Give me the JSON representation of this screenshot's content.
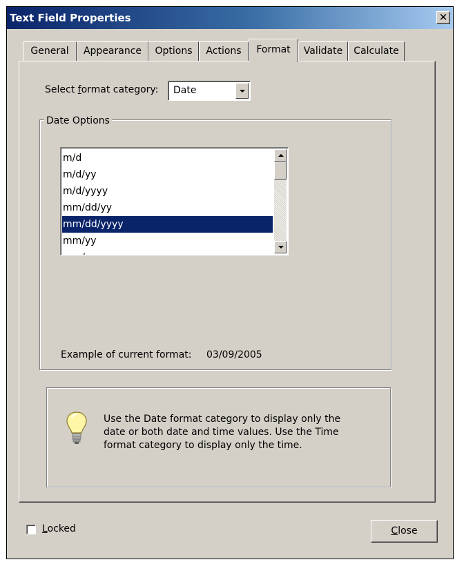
{
  "window": {
    "title": "Text Field Properties",
    "close_glyph": "✕"
  },
  "tabs": [
    {
      "label": "General",
      "active": false
    },
    {
      "label": "Appearance",
      "active": false
    },
    {
      "label": "Options",
      "active": false
    },
    {
      "label": "Actions",
      "active": false
    },
    {
      "label": "Format",
      "active": true
    },
    {
      "label": "Validate",
      "active": false
    },
    {
      "label": "Calculate",
      "active": false
    }
  ],
  "format": {
    "category_label_pre": "Select ",
    "category_label_accel": "f",
    "category_label_post": "ormat category:",
    "category_value": "Date",
    "group_title": "Date Options",
    "options": [
      "m/d",
      "m/d/yy",
      "m/d/yyyy",
      "mm/dd/yy",
      "mm/dd/yyyy",
      "mm/yy",
      "mm/yyyy"
    ],
    "selected_option": "mm/dd/yyyy",
    "example_label": "Example of current format:",
    "example_value": "03/09/2005"
  },
  "info": {
    "icon": "lightbulb-icon",
    "lines": [
      "Use the Date format category to display only the",
      "date or both date and time values. Use the Time",
      "format category to display only the time."
    ]
  },
  "footer": {
    "locked_accel": "L",
    "locked_rest": "ocked",
    "locked_checked": false,
    "close_accel": "C",
    "close_rest": "lose"
  },
  "colors": {
    "title_bar": "#0a246a",
    "selection": "#0a246a",
    "dialog_face": "#d4d0c8"
  }
}
